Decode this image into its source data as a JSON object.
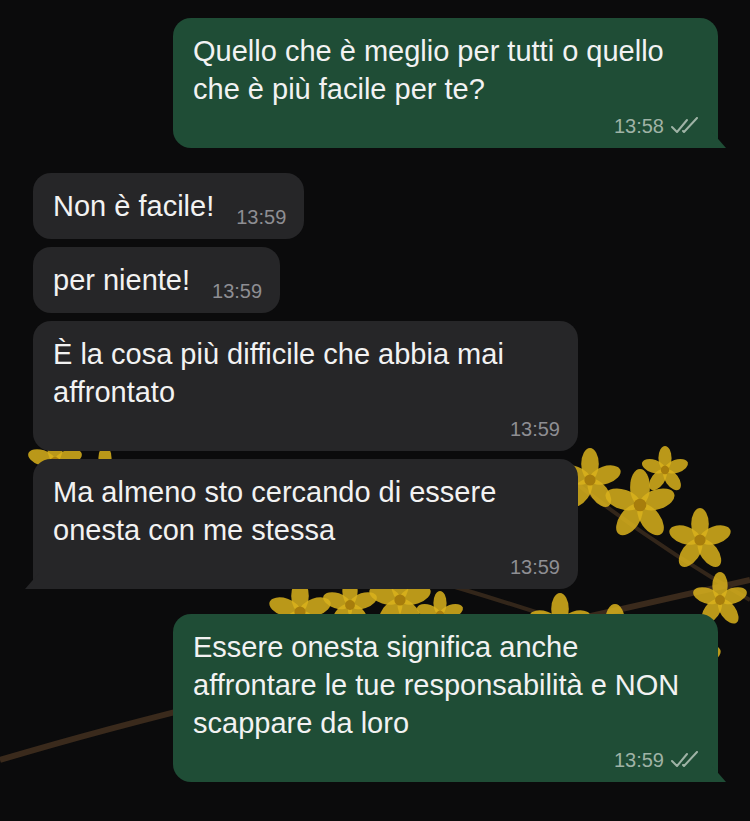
{
  "chat": {
    "messages": [
      {
        "direction": "sent",
        "text": "Quello che è meglio per tutti o quello che è più facile per te?",
        "time": "13:58",
        "status": "delivered",
        "tail": true
      },
      {
        "direction": "received",
        "text": "Non è facile!",
        "time": "13:59",
        "tail": false
      },
      {
        "direction": "received",
        "text": "per niente!",
        "time": "13:59",
        "tail": false
      },
      {
        "direction": "received",
        "text": "È la cosa più difficile che abbia mai affrontato",
        "time": "13:59",
        "tail": false
      },
      {
        "direction": "received",
        "text": "Ma almeno sto cercando di essere onesta con me stessa",
        "time": "13:59",
        "tail": true
      },
      {
        "direction": "sent",
        "text": "Essere onesta significa anche affrontare le tue responsabilità e NON scappare da loro",
        "time": "13:59",
        "status": "delivered",
        "tail": true
      }
    ]
  }
}
